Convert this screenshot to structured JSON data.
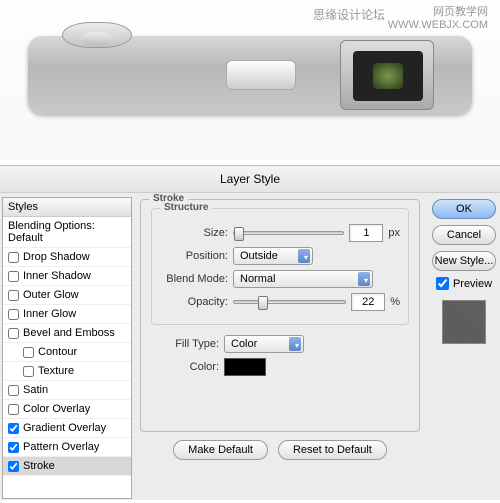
{
  "watermarks": {
    "w1": "思缘设计论坛",
    "w2a": "网页教学网",
    "w2b": "WWW.WEBJX.COM"
  },
  "dialog": {
    "title": "Layer Style",
    "sidebar": {
      "header": "Styles",
      "blending": "Blending Options: Default",
      "items": [
        {
          "label": "Drop Shadow",
          "checked": false
        },
        {
          "label": "Inner Shadow",
          "checked": false
        },
        {
          "label": "Outer Glow",
          "checked": false
        },
        {
          "label": "Inner Glow",
          "checked": false
        },
        {
          "label": "Bevel and Emboss",
          "checked": false
        },
        {
          "label": "Contour",
          "checked": false,
          "indent": true
        },
        {
          "label": "Texture",
          "checked": false,
          "indent": true
        },
        {
          "label": "Satin",
          "checked": false
        },
        {
          "label": "Color Overlay",
          "checked": false
        },
        {
          "label": "Gradient Overlay",
          "checked": true
        },
        {
          "label": "Pattern Overlay",
          "checked": true
        },
        {
          "label": "Stroke",
          "checked": true,
          "active": true
        }
      ]
    },
    "panel": {
      "heading": "Stroke",
      "structure": "Structure",
      "size_label": "Size:",
      "size_value": "1",
      "size_unit": "px",
      "position_label": "Position:",
      "position_value": "Outside",
      "blend_label": "Blend Mode:",
      "blend_value": "Normal",
      "opacity_label": "Opacity:",
      "opacity_value": "22",
      "opacity_unit": "%",
      "filltype_label": "Fill Type:",
      "filltype_value": "Color",
      "color_label": "Color:",
      "color_value": "#000000",
      "make_default": "Make Default",
      "reset_default": "Reset to Default"
    },
    "buttons": {
      "ok": "OK",
      "cancel": "Cancel",
      "newstyle": "New Style...",
      "preview": "Preview"
    }
  }
}
